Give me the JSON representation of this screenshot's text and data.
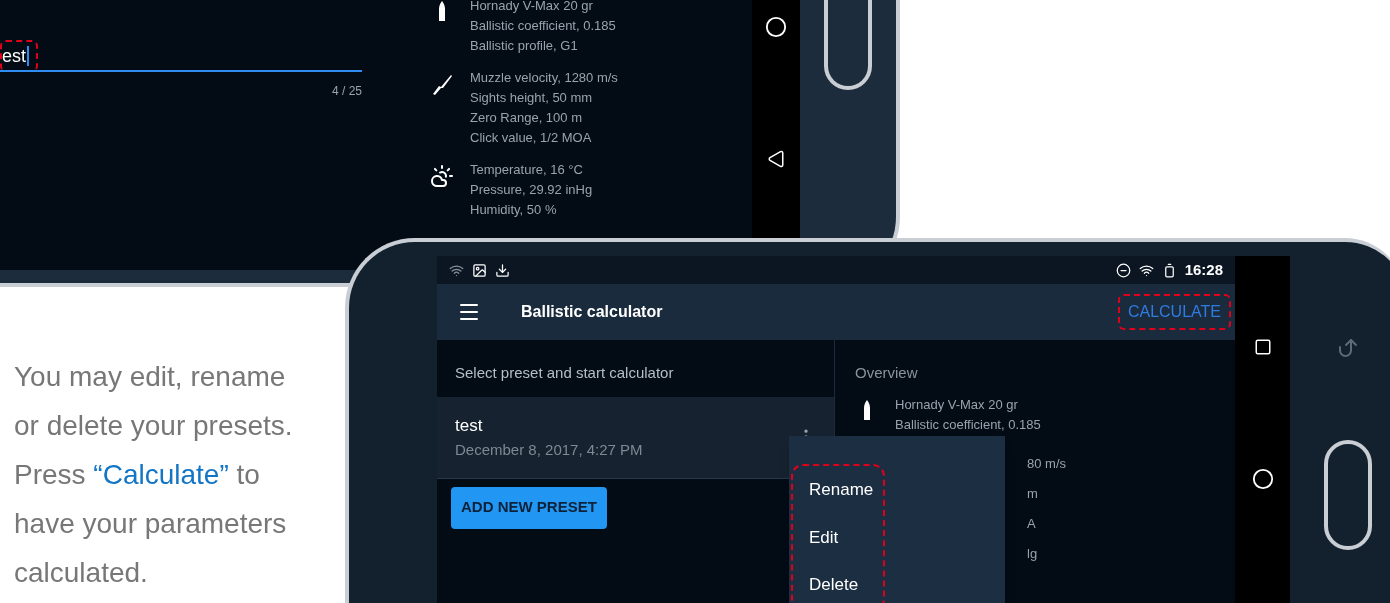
{
  "back_phone": {
    "name_field": {
      "value": "est",
      "counter": "4 / 25",
      "highlighted": true
    },
    "overview": [
      {
        "kind": "bullet",
        "lines": [
          "Hornady V-Max 20 gr",
          "Ballistic coefficient, 0.185",
          "Ballistic profile, G1"
        ]
      },
      {
        "kind": "rifle",
        "lines": [
          "Muzzle velocity, 1280 m/s",
          "Sights height, 50 mm",
          "Zero Range, 100 m",
          "Click value, 1/2 MOA"
        ]
      },
      {
        "kind": "weather",
        "lines": [
          "Temperature, 16 °C",
          "Pressure, 29.92 inHg",
          "Humidity, 50 %"
        ]
      }
    ]
  },
  "description": {
    "before": "You may edit, rename or delete your presets. Press ",
    "link": "“Calculate”",
    "after": " to have your parameters calculated."
  },
  "front_phone": {
    "status_bar": {
      "time": "16:28"
    },
    "toolbar": {
      "title": "Ballistic calculator",
      "action": "CALCULATE",
      "action_highlighted": true
    },
    "presets_heading": "Select preset and start calculator",
    "presets": [
      {
        "name": "test",
        "date": "December 8, 2017, 4:27 PM"
      }
    ],
    "add_button": "ADD NEW PRESET",
    "overview_heading": "Overview",
    "overview": [
      {
        "kind": "bullet",
        "lines": [
          "Hornady V-Max 20 gr",
          "Ballistic coefficient, 0.185"
        ]
      }
    ],
    "overview_fragments": [
      "80 m/s",
      "m",
      "A",
      "lg"
    ],
    "menu": {
      "items": [
        "Rename",
        "Edit",
        "Delete"
      ],
      "highlighted": true
    }
  }
}
